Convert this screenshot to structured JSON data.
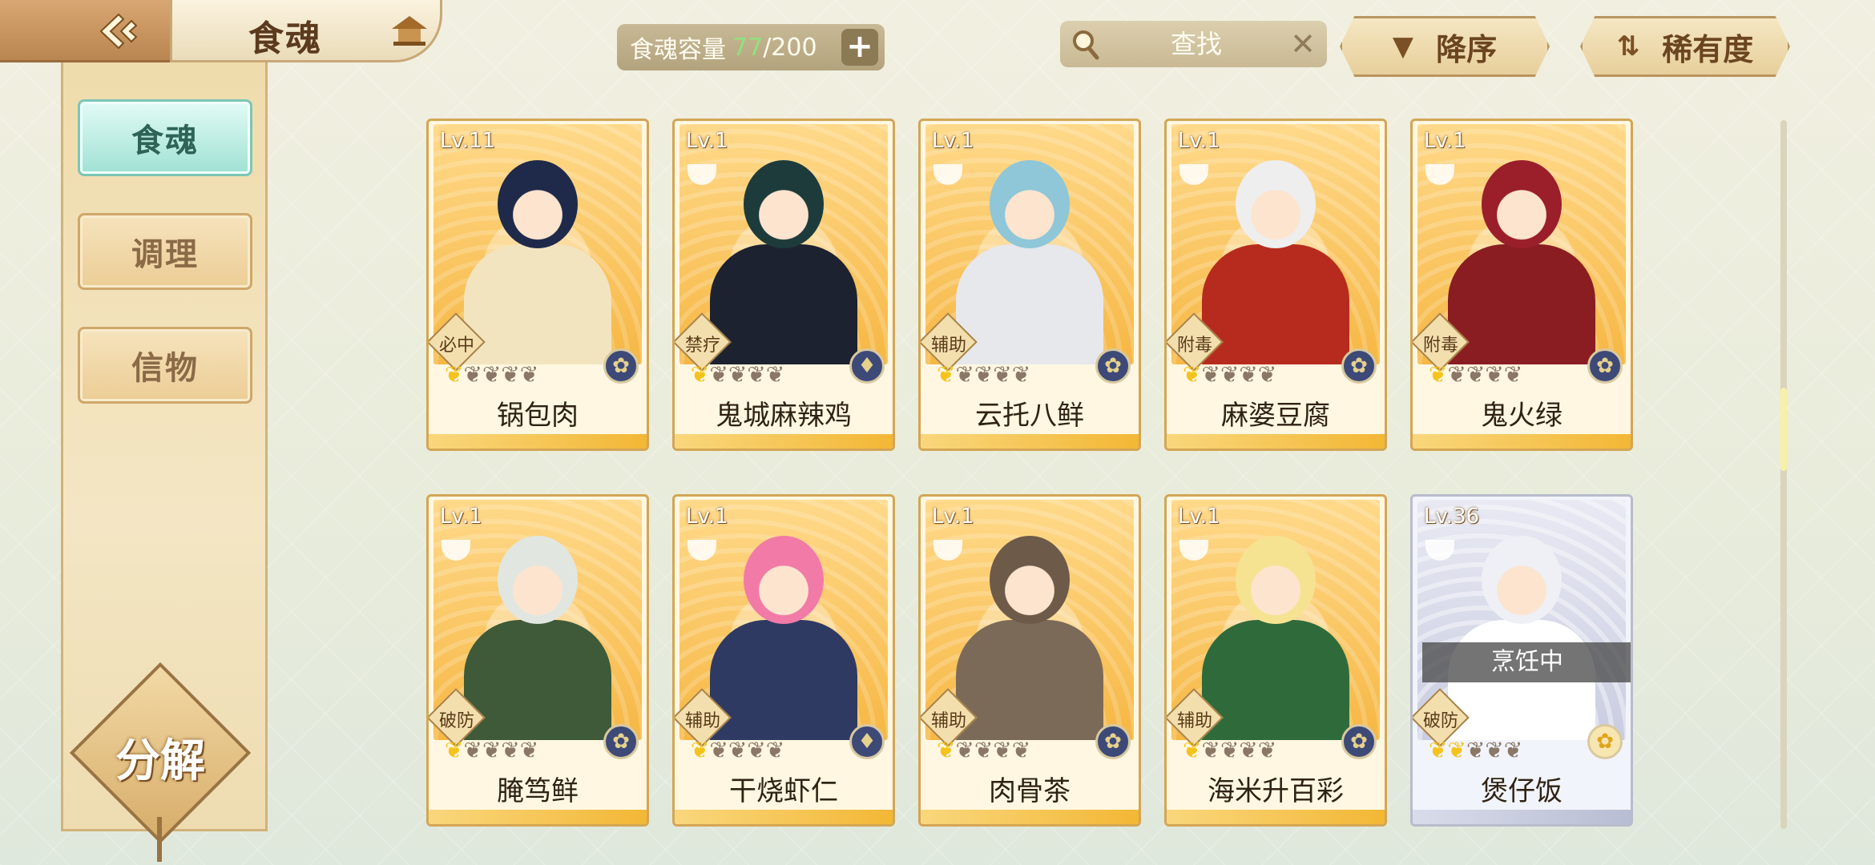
{
  "header": {
    "title": "食魂",
    "capacity_label": "食魂容量",
    "capacity_current": "77",
    "capacity_max": "/200",
    "add_symbol": "+",
    "search_placeholder": "查找",
    "clear_symbol": "✕",
    "sort_desc_label": "降序",
    "sort_rarity_label": "稀有度"
  },
  "sidebar": {
    "items": [
      {
        "label": "食魂",
        "active": true
      },
      {
        "label": "调理",
        "active": false
      },
      {
        "label": "信物",
        "active": false
      }
    ],
    "decompose_label": "分解"
  },
  "colors": {
    "gold_card": "#d3a654",
    "silver_card": "#b8bccb",
    "star_on": "#f5c31b",
    "star_off": "#8b7766",
    "capacity_value": "#8fe27f",
    "active_tab": "#9fe1d4"
  },
  "cards": [
    {
      "level": "Lv.11",
      "name": "锅包肉",
      "role": "必中",
      "stars": 1,
      "rarity": "gold",
      "element": "blue-flower-icon",
      "hair": "#1f2a4a",
      "outfit": "#f3e4c0"
    },
    {
      "level": "Lv.1",
      "name": "鬼城麻辣鸡",
      "role": "禁疗",
      "stars": 1,
      "rarity": "gold",
      "element": "blue-flame-icon",
      "hair": "#1d3b3b",
      "outfit": "#1d2230"
    },
    {
      "level": "Lv.1",
      "name": "云托八鲜",
      "role": "辅助",
      "stars": 1,
      "rarity": "gold",
      "element": "blue-flower-icon",
      "hair": "#8fc6d8",
      "outfit": "#e6e8ec"
    },
    {
      "level": "Lv.1",
      "name": "麻婆豆腐",
      "role": "附毒",
      "stars": 1,
      "rarity": "gold",
      "element": "blue-flower-icon",
      "hair": "#eeeeee",
      "outfit": "#b62b1d"
    },
    {
      "level": "Lv.1",
      "name": "鬼火绿",
      "role": "附毒",
      "stars": 1,
      "rarity": "gold",
      "element": "blue-flower-icon",
      "hair": "#9a1f2a",
      "outfit": "#8a1d22"
    },
    {
      "level": "Lv.1",
      "name": "腌笃鲜",
      "role": "破防",
      "stars": 1,
      "rarity": "gold",
      "element": "blue-flower-icon",
      "hair": "#e1e7e0",
      "outfit": "#3e5a38"
    },
    {
      "level": "Lv.1",
      "name": "干烧虾仁",
      "role": "辅助",
      "stars": 1,
      "rarity": "gold",
      "element": "blue-flame-icon",
      "hair": "#f27aa6",
      "outfit": "#2f3a63"
    },
    {
      "level": "Lv.1",
      "name": "肉骨茶",
      "role": "辅助",
      "stars": 1,
      "rarity": "gold",
      "element": "blue-flower-icon",
      "hair": "#6e5a48",
      "outfit": "#7c6a58"
    },
    {
      "level": "Lv.1",
      "name": "海米升百彩",
      "role": "辅助",
      "stars": 1,
      "rarity": "gold",
      "element": "blue-flower-icon",
      "hair": "#f6e392",
      "outfit": "#2f6b3a"
    },
    {
      "level": "Lv.36",
      "name": "煲仔饭",
      "role": "破防",
      "stars": 2,
      "rarity": "silver",
      "element": "gold-flower-icon",
      "hair": "#eef0f6",
      "outfit": "#ffffff",
      "status": "烹饪中"
    }
  ]
}
